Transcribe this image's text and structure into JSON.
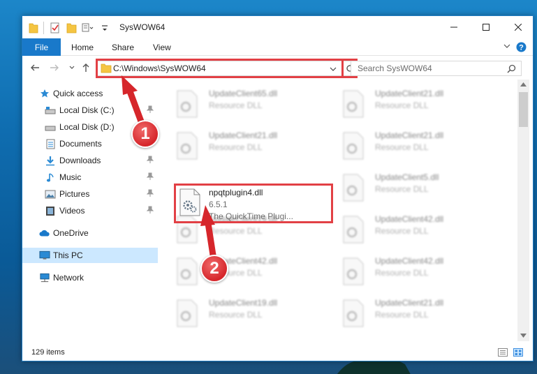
{
  "window": {
    "title": "SysWOW64"
  },
  "ribbon": {
    "tabs": [
      "File",
      "Home",
      "Share",
      "View"
    ]
  },
  "address": {
    "path": "C:\\Windows\\SysWOW64",
    "search_placeholder": "Search SysWOW64"
  },
  "nav": {
    "items": [
      {
        "label": "Quick access",
        "icon": "star-icon",
        "pinned": false
      },
      {
        "label": "Local Disk (C:)",
        "icon": "drive-icon",
        "pinned": true
      },
      {
        "label": "Local Disk (D:)",
        "icon": "drive-icon",
        "pinned": false
      },
      {
        "label": "Documents",
        "icon": "documents-icon",
        "pinned": true
      },
      {
        "label": "Downloads",
        "icon": "downloads-icon",
        "pinned": true
      },
      {
        "label": "Music",
        "icon": "music-icon",
        "pinned": true
      },
      {
        "label": "Pictures",
        "icon": "pictures-icon",
        "pinned": true
      },
      {
        "label": "Videos",
        "icon": "videos-icon",
        "pinned": true
      },
      {
        "label": "OneDrive",
        "icon": "onedrive-icon",
        "pinned": false
      },
      {
        "label": "This PC",
        "icon": "pc-icon",
        "pinned": false,
        "selected": true
      },
      {
        "label": "Network",
        "icon": "network-icon",
        "pinned": false
      }
    ]
  },
  "files": [
    {
      "name": "UpdateClient65.dll",
      "type": "Resource DLL"
    },
    {
      "name": "UpdateClient21.dll",
      "type": "Resource DLL"
    },
    {
      "name": "UpdateClient21.dll",
      "type": "Resource DLL"
    },
    {
      "name": "UpdateClient21.dll",
      "type": "Resource DLL"
    },
    {
      "name": "UpdateClient5.dll",
      "type": "Resource DLL"
    },
    {
      "name": "UpdateClient19.dll",
      "type": "Resource DLL"
    },
    {
      "name": "UpdateClient42.dll",
      "type": "Resource DLL"
    },
    {
      "name": "UpdateClient42.dll",
      "type": "Resource DLL"
    },
    {
      "name": "UpdateClient42.dll",
      "type": "Resource DLL"
    },
    {
      "name": "UpdateClient19.dll",
      "type": "Resource DLL"
    },
    {
      "name": "UpdateClient21.dll",
      "type": "Resource DLL"
    }
  ],
  "selected_file": {
    "name": "npqtplugin4.dll",
    "version": "6.5.1",
    "description": "The QuickTime Plugi..."
  },
  "status": {
    "count": "129 items"
  },
  "annotations": {
    "step1": "1",
    "step2": "2",
    "highlight_color": "#e24045"
  }
}
